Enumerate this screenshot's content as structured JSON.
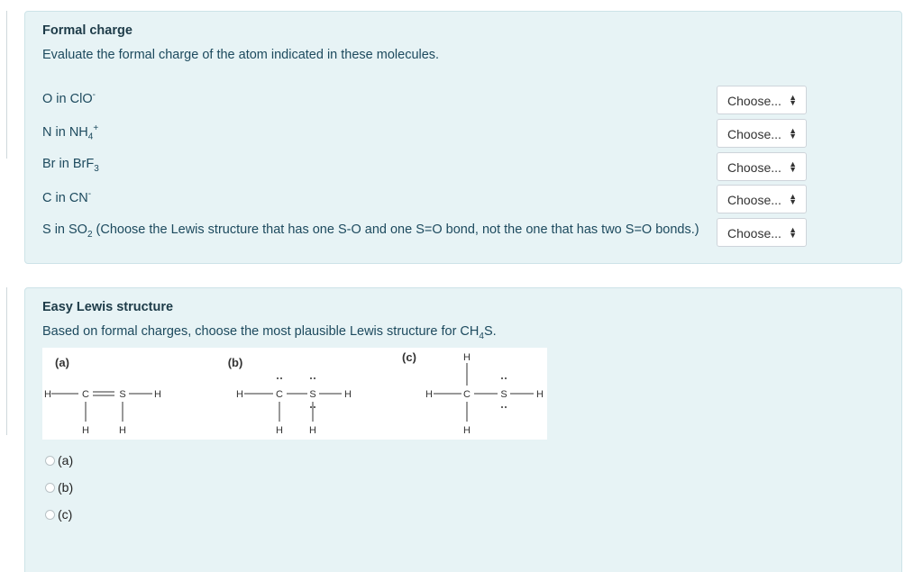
{
  "q1": {
    "title": "Formal charge",
    "instruction": "Evaluate the formal charge of the atom indicated in these molecules.",
    "rows": [
      {
        "pre": "O in ClO",
        "sub": "",
        "sup": "-",
        "post": "",
        "select": "Choose..."
      },
      {
        "pre": "N in NH",
        "sub": "4",
        "sup": "+",
        "post": "",
        "select": "Choose..."
      },
      {
        "pre": "Br in BrF",
        "sub": "3",
        "sup": "",
        "post": "",
        "select": "Choose..."
      },
      {
        "pre": "C in CN",
        "sub": "",
        "sup": "-",
        "post": "",
        "select": "Choose..."
      },
      {
        "pre": "S in SO",
        "sub": "2",
        "sup": "",
        "post": " (Choose the Lewis structure that has one S-O and one S=O bond, not the one that has two S=O bonds.)",
        "select": "Choose..."
      }
    ]
  },
  "q2": {
    "title": "Easy Lewis structure",
    "instruction_pre": "Based on formal charges, choose the most plausible Lewis structure for CH",
    "instruction_sub": "4",
    "instruction_post": "S.",
    "structures": {
      "a": {
        "label": "(a)",
        "atoms": [
          "H",
          "C",
          "S",
          "H",
          "H",
          "H"
        ]
      },
      "b": {
        "label": "(b)",
        "atoms": [
          "H",
          "C",
          "S",
          "H",
          "H",
          "H"
        ]
      },
      "c": {
        "label": "(c)",
        "atoms": [
          "H",
          "H",
          "C",
          "S",
          "H",
          "H"
        ]
      }
    },
    "options": [
      "(a)",
      "(b)",
      "(c)"
    ]
  }
}
